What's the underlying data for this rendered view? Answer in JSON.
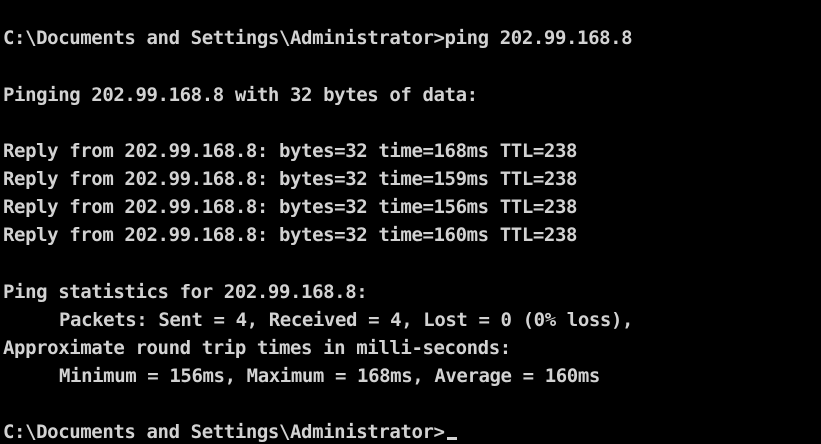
{
  "console": {
    "command_line": "C:\\Documents and Settings\\Administrator>ping 202.99.168.8",
    "pinging_line": "Pinging 202.99.168.8 with 32 bytes of data:",
    "replies": [
      "Reply from 202.99.168.8: bytes=32 time=168ms TTL=238",
      "Reply from 202.99.168.8: bytes=32 time=159ms TTL=238",
      "Reply from 202.99.168.8: bytes=32 time=156ms TTL=238",
      "Reply from 202.99.168.8: bytes=32 time=160ms TTL=238"
    ],
    "stats_header": "Ping statistics for 202.99.168.8:",
    "packets_line": "Packets: Sent = 4, Received = 4, Lost = 0 (0% loss),",
    "rtt_header": "Approximate round trip times in milli-seconds:",
    "rtt_line": "Minimum = 156ms, Maximum = 168ms, Average = 160ms",
    "prompt_line": "C:\\Documents and Settings\\Administrator>",
    "colors": {
      "background": "#000000",
      "text": "#d2d2d2"
    }
  }
}
